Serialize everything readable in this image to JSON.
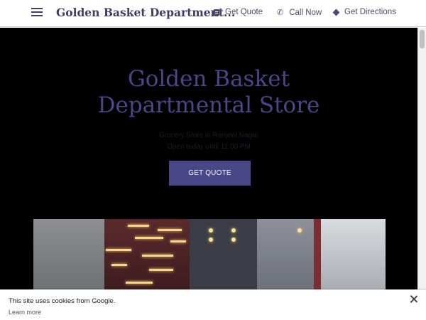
{
  "header": {
    "brand": "Golden Basket Department...",
    "nav": [
      {
        "label": "Get Quote",
        "icon": "quote-document-icon"
      },
      {
        "label": "Call Now",
        "icon": "phone-icon"
      },
      {
        "label": "Get Directions",
        "icon": "directions-icon"
      }
    ]
  },
  "hero": {
    "title_line1": "Golden Basket",
    "title_line2": "Departmental Store",
    "category": "Grocery Store in Ranjeet Nagar",
    "hours": "Open today until 11:00 PM",
    "cta_label": "GET QUOTE"
  },
  "cookie_banner": {
    "message": "This site uses cookies from Google.",
    "learn_more": "Learn more"
  },
  "colors": {
    "accent": "#4a4788",
    "hero_background": "#000000",
    "nav_text": "#4a4a6a"
  }
}
